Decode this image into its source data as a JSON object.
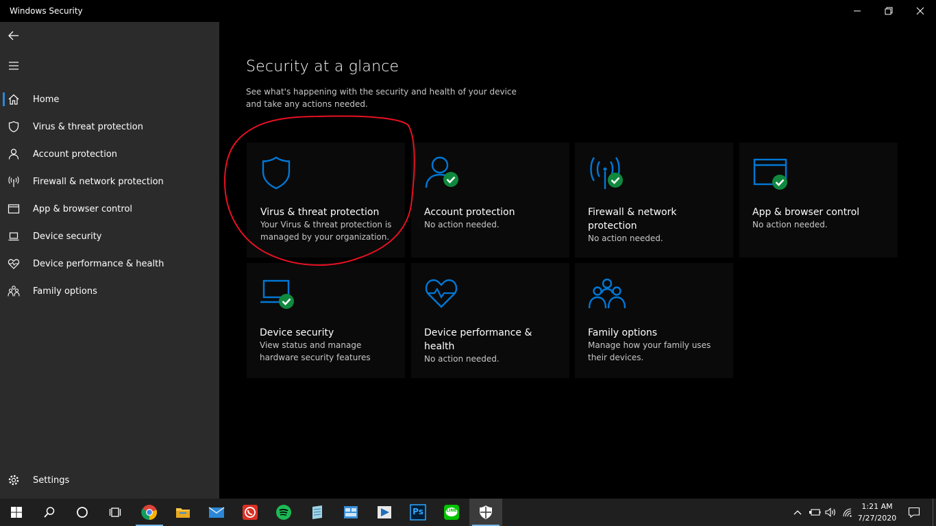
{
  "window": {
    "title": "Windows Security"
  },
  "sidebar": {
    "items": [
      {
        "label": "Home",
        "icon": "home-icon",
        "active": true
      },
      {
        "label": "Virus & threat protection",
        "icon": "shield-icon"
      },
      {
        "label": "Account protection",
        "icon": "person-icon"
      },
      {
        "label": "Firewall & network protection",
        "icon": "antenna-icon"
      },
      {
        "label": "App & browser control",
        "icon": "browser-window-icon"
      },
      {
        "label": "Device security",
        "icon": "laptop-icon"
      },
      {
        "label": "Device performance & health",
        "icon": "heart-pulse-icon"
      },
      {
        "label": "Family options",
        "icon": "family-icon"
      }
    ],
    "settings_label": "Settings"
  },
  "main": {
    "title": "Security at a glance",
    "subtitle": "See what's happening with the security and health of your device and take any actions needed.",
    "tiles": [
      {
        "name": "Virus & threat protection",
        "status": "Your Virus & threat protection is managed by your organization.",
        "icon": "shield-icon",
        "check": false
      },
      {
        "name": "Account protection",
        "status": "No action needed.",
        "icon": "person-icon",
        "check": true
      },
      {
        "name": "Firewall & network protection",
        "status": "No action needed.",
        "icon": "antenna-icon",
        "check": true
      },
      {
        "name": "App & browser control",
        "status": "No action needed.",
        "icon": "browser-window-icon",
        "check": true
      },
      {
        "name": "Device security",
        "status": "View status and manage hardware security features",
        "icon": "laptop-icon",
        "check": true
      },
      {
        "name": "Device performance & health",
        "status": "No action needed.",
        "icon": "heart-pulse-icon",
        "check": false
      },
      {
        "name": "Family options",
        "status": "Manage how your family uses their devices.",
        "icon": "family-icon",
        "check": false
      }
    ]
  },
  "taskbar": {
    "apps": [
      "start-icon",
      "search-icon",
      "cortana-icon",
      "task-view-icon",
      "chrome-icon",
      "file-explorer-icon",
      "mail-icon",
      "whatsapp-icon",
      "spotify-icon",
      "notepad-icon",
      "control-panel-icon",
      "media-player-icon",
      "photoshop-icon",
      "line-icon",
      "windows-security-icon"
    ],
    "photoshop_label": "Ps",
    "line_label": "LINE",
    "clock": {
      "time": "1:21 AM",
      "date": "7/27/2020"
    }
  },
  "colors": {
    "accent": "#0078d7",
    "check": "#10893e",
    "sidebar": "#2b2b2b",
    "annotation": "#e81123"
  }
}
